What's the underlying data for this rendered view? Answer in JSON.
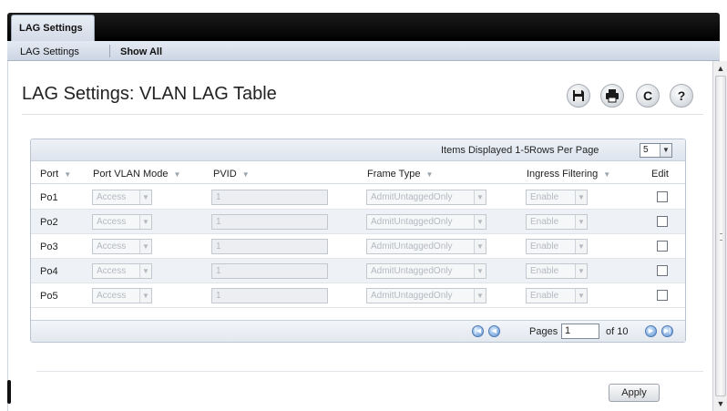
{
  "tab": {
    "label": "LAG Settings"
  },
  "subnav": {
    "items": [
      {
        "label": "LAG Settings"
      },
      {
        "label": "Show All"
      }
    ]
  },
  "page": {
    "title": "LAG Settings: VLAN LAG Table"
  },
  "toolbar": {
    "icons": [
      "save-icon",
      "print-icon",
      "refresh-icon",
      "help-icon"
    ],
    "refresh_glyph": "C",
    "help_glyph": "?"
  },
  "table": {
    "items_displayed": "Items Displayed 1-5",
    "rows_per_page_label": "Rows Per Page",
    "rows_per_page_value": "5",
    "headers": {
      "port": "Port",
      "mode": "Port VLAN Mode",
      "pvid": "PVID",
      "frame": "Frame Type",
      "ingress": "Ingress Filtering",
      "edit": "Edit"
    },
    "rows": [
      {
        "port": "Po1",
        "mode": "Access",
        "pvid": "1",
        "frame": "AdmitUntaggedOnly",
        "ingress": "Enable"
      },
      {
        "port": "Po2",
        "mode": "Access",
        "pvid": "1",
        "frame": "AdmitUntaggedOnly",
        "ingress": "Enable"
      },
      {
        "port": "Po3",
        "mode": "Access",
        "pvid": "1",
        "frame": "AdmitUntaggedOnly",
        "ingress": "Enable"
      },
      {
        "port": "Po4",
        "mode": "Access",
        "pvid": "1",
        "frame": "AdmitUntaggedOnly",
        "ingress": "Enable"
      },
      {
        "port": "Po5",
        "mode": "Access",
        "pvid": "1",
        "frame": "AdmitUntaggedOnly",
        "ingress": "Enable"
      }
    ]
  },
  "pager": {
    "pages_label": "Pages",
    "current_page": "1",
    "total_label": "of 10"
  },
  "footer": {
    "apply_label": "Apply"
  }
}
